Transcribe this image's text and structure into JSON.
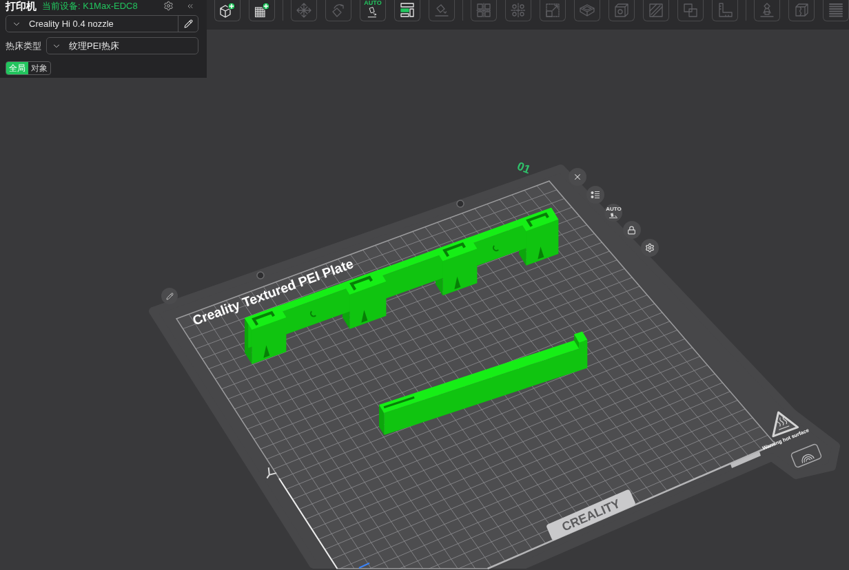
{
  "printer_panel": {
    "title": "打印机",
    "current_device": "当前设备: K1Max-EDC8",
    "nozzle": "Creality Hi 0.4 nozzle",
    "bed_type": {
      "label": "热床类型",
      "value": "纹理PEI热床"
    },
    "scope_tabs": [
      {
        "label": "全局",
        "selected": true
      },
      {
        "label": "对象",
        "selected": false
      }
    ]
  },
  "toolbar": {
    "groups": [
      [
        {
          "kind": "add-model",
          "disabled": false
        },
        {
          "kind": "add-plate",
          "disabled": false
        }
      ],
      [
        {
          "kind": "move-arrows",
          "disabled": true
        },
        {
          "kind": "rotate",
          "disabled": true
        },
        {
          "kind": "auto-orient",
          "badge": "AUTO",
          "disabled": false
        },
        {
          "kind": "arrange",
          "disabled": false
        },
        {
          "kind": "lay-on-face",
          "disabled": true
        }
      ],
      [
        {
          "kind": "split-grid",
          "disabled": true
        },
        {
          "kind": "gear-grid",
          "disabled": true
        },
        {
          "kind": "scale",
          "disabled": true
        },
        {
          "kind": "cut",
          "disabled": true
        },
        {
          "kind": "hollow",
          "disabled": true
        },
        {
          "kind": "paint",
          "disabled": true
        },
        {
          "kind": "boolean",
          "disabled": true
        },
        {
          "kind": "measure",
          "disabled": true
        }
      ],
      [
        {
          "kind": "support",
          "disabled": true
        },
        {
          "kind": "seam",
          "disabled": true
        },
        {
          "kind": "layers",
          "disabled": true
        }
      ]
    ]
  },
  "plate": {
    "number": "01",
    "name": "Creality Textured PEI Plate",
    "controls": [
      {
        "kind": "close"
      },
      {
        "kind": "list"
      },
      {
        "kind": "auto-orient",
        "badge": "AUTO"
      },
      {
        "kind": "lock"
      },
      {
        "kind": "settings"
      }
    ],
    "warning": "Warning hot surface",
    "brand": "CREALITY"
  }
}
